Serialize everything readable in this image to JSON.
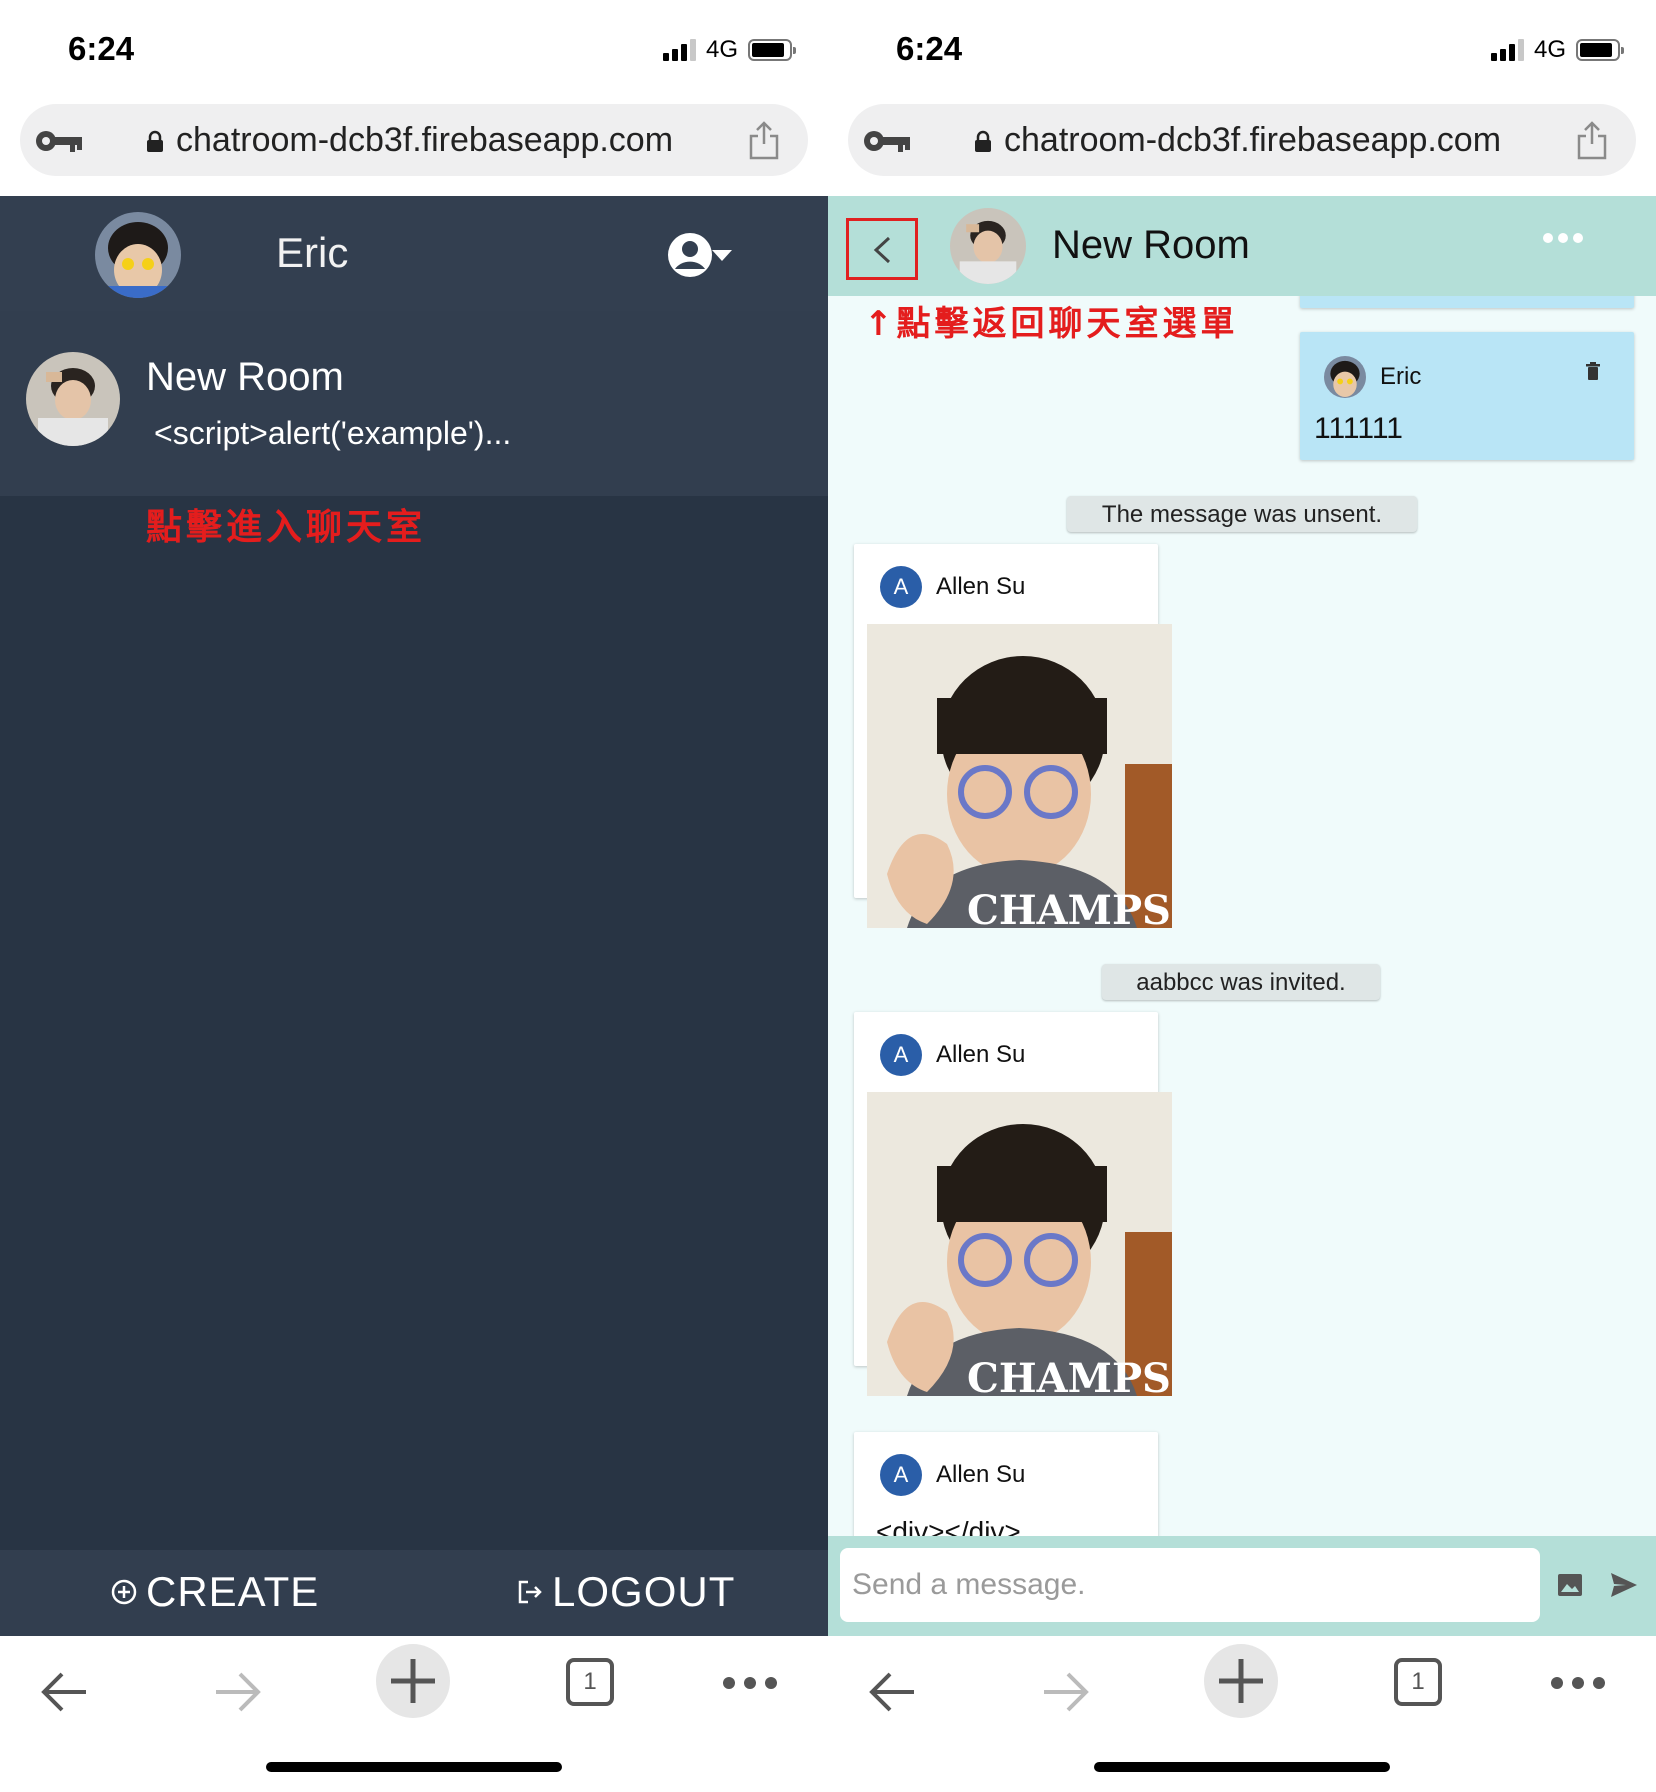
{
  "status_bar": {
    "time": "6:24",
    "network": "4G"
  },
  "browser": {
    "url": "chatroom-dcb3f.firebaseapp.com",
    "tab_count": "1"
  },
  "room_list_screen": {
    "user_name": "Eric",
    "rooms": [
      {
        "name": "New Room",
        "last_message": "<script>alert('example')..."
      }
    ],
    "annotation": "點擊進入聊天室",
    "create_label": "CREATE",
    "logout_label": "LOGOUT"
  },
  "chat_screen": {
    "room_title": "New Room",
    "annotation": "↑點擊返回聊天室選單",
    "own_message": {
      "sender": "Eric",
      "text": "111111"
    },
    "system_unsent": "The message was unsent.",
    "system_invited": "aabbcc was invited.",
    "messages": [
      {
        "sender": "Allen Su",
        "avatar_letter": "A",
        "kind": "image"
      },
      {
        "sender": "Allen Su",
        "avatar_letter": "A",
        "kind": "image"
      },
      {
        "sender": "Allen Su",
        "avatar_letter": "A",
        "kind": "text",
        "text": "<div></div>"
      }
    ],
    "input_placeholder": "Send a message."
  },
  "colors": {
    "left_bg": "#283444",
    "left_header": "#333f50",
    "chat_bg": "#f0fbfb",
    "chat_header": "#b4dfd8",
    "own_bubble": "#b9e5f6",
    "annotation": "#e41d1d"
  },
  "icons": [
    "key-icon",
    "lock-icon",
    "share-icon",
    "account-menu-icon",
    "create-icon",
    "logout-icon",
    "back-icon",
    "more-icon",
    "trash-icon",
    "image-icon",
    "send-icon",
    "arrow-left-icon",
    "arrow-right-icon",
    "plus-icon",
    "tabs-icon",
    "ellipsis-icon"
  ]
}
